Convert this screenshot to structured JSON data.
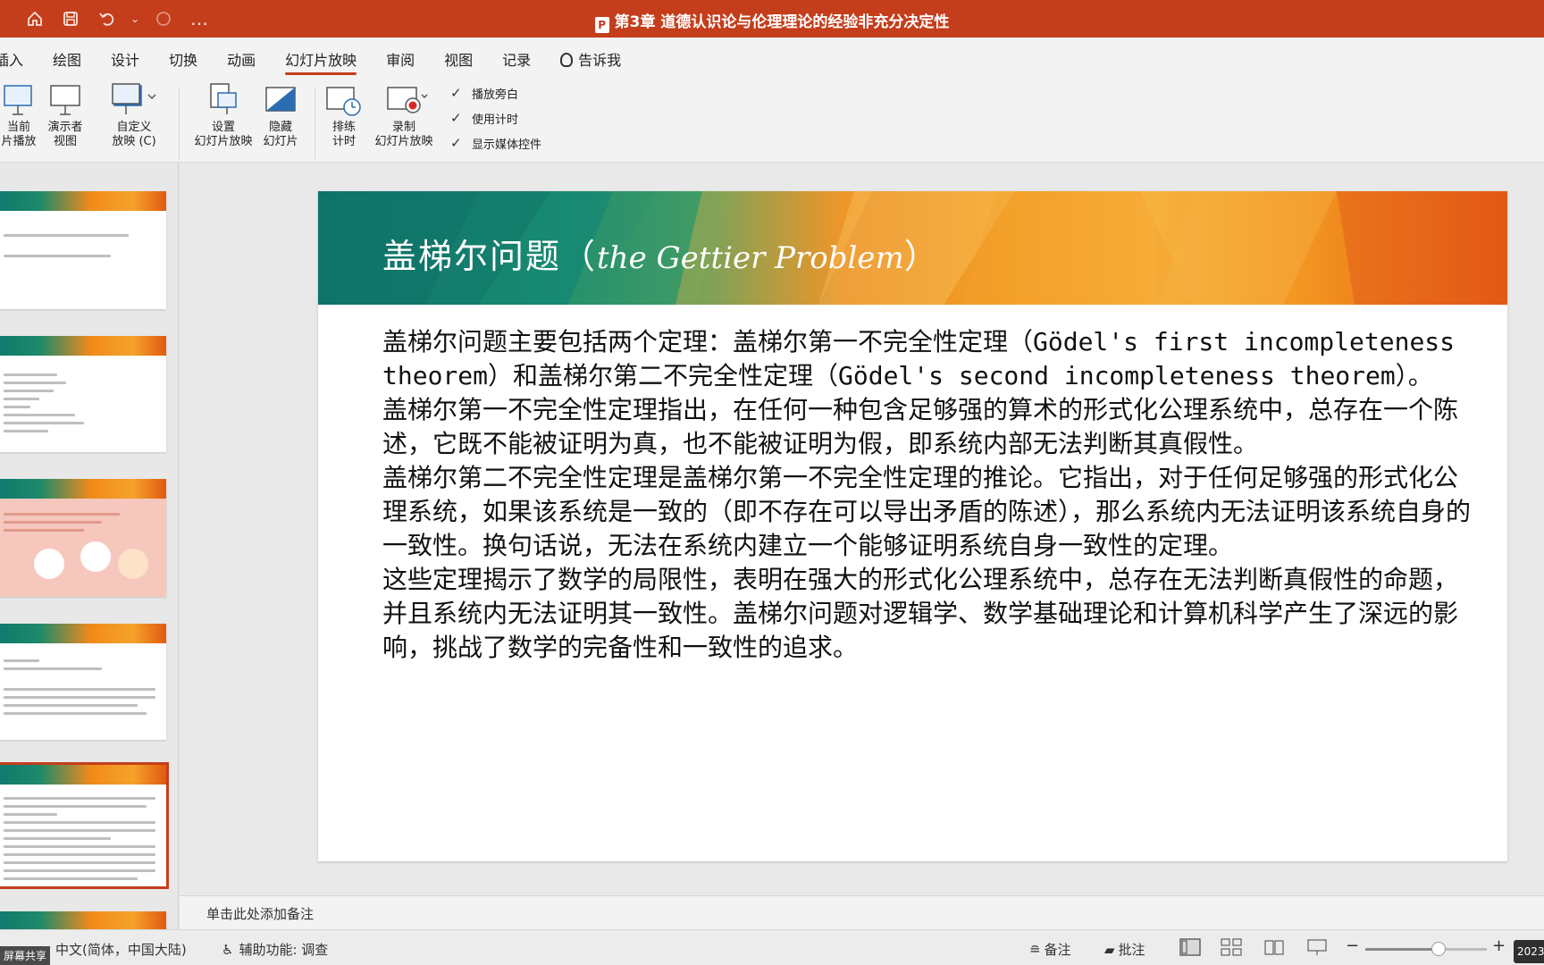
{
  "window": {
    "title": "第3章 道德认识论与伦理理论的经验非充分决定性"
  },
  "quick_access": {
    "home": "home-icon",
    "save": "save-icon",
    "undo": "undo-icon",
    "redo": "redo-icon",
    "more": "…"
  },
  "ribbon": {
    "tabs": [
      "插入",
      "绘图",
      "设计",
      "切换",
      "动画",
      "幻灯片放映",
      "审阅",
      "视图",
      "记录",
      "告诉我"
    ],
    "active_tab": "幻灯片放映",
    "tools": {
      "from_current_1": "当前",
      "from_current_2": "片播放",
      "presenter_1": "演示者",
      "presenter_2": "视图",
      "custom_1": "自定义",
      "custom_2": "放映 (C)",
      "setup_1": "设置",
      "setup_2": "幻灯片放映",
      "hide_1": "隐藏",
      "hide_2": "幻灯片",
      "rehearse_1": "排练",
      "rehearse_2": "计时",
      "record_1": "录制",
      "record_2": "幻灯片放映"
    },
    "checks": [
      "播放旁白",
      "使用计时",
      "显示媒体控件"
    ]
  },
  "slide": {
    "title_cn": "盖梯尔问题（",
    "title_en": "the Gettier Problem",
    "title_close": "）",
    "paragraphs": [
      "盖梯尔问题主要包括两个定理：盖梯尔第一不完全性定理（Gödel's first incompleteness theorem）和盖梯尔第二不完全性定理（Gödel's second incompleteness theorem）。",
      "盖梯尔第一不完全性定理指出，在任何一种包含足够强的算术的形式化公理系统中，总存在一个陈述，它既不能被证明为真，也不能被证明为假，即系统内部无法判断其真假性。",
      "盖梯尔第二不完全性定理是盖梯尔第一不完全性定理的推论。它指出，对于任何足够强的形式化公理系统，如果该系统是一致的（即不存在可以导出矛盾的陈述），那么系统内无法证明该系统自身的一致性。换句话说，无法在系统内建立一个能够证明系统自身一致性的定理。",
      "这些定理揭示了数学的局限性，表明在强大的形式化公理系统中，总存在无法判断真假性的命题，并且系统内无法证明其一致性。盖梯尔问题对逻辑学、数学基础理论和计算机科学产生了深远的影响，挑战了数学的完备性和一致性的追求。"
    ]
  },
  "notes": {
    "placeholder": "单击此处添加备注"
  },
  "status": {
    "share": "屏幕共享",
    "language": "中文(简体，中国大陆)",
    "accessibility": "辅助功能: 调查",
    "notes_btn": "备注",
    "comments_btn": "批注",
    "date": "2023/",
    "zoom_level": 0.6
  }
}
